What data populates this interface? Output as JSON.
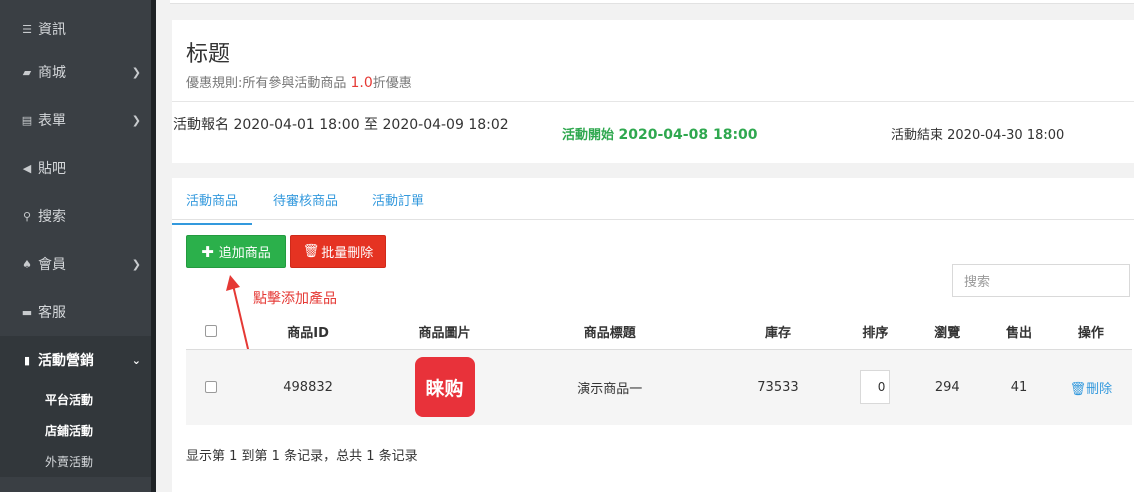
{
  "sidebar": {
    "items": [
      {
        "label": "資訊",
        "icon": "list-icon",
        "chevron": false
      },
      {
        "label": "商城",
        "icon": "cart-icon",
        "chevron": true
      },
      {
        "label": "表單",
        "icon": "form-icon",
        "chevron": true
      },
      {
        "label": "貼吧",
        "icon": "megaphone-icon",
        "chevron": false
      },
      {
        "label": "搜索",
        "icon": "search-icon",
        "chevron": false
      },
      {
        "label": "會員",
        "icon": "bell-icon",
        "chevron": true
      },
      {
        "label": "客服",
        "icon": "chat-icon",
        "chevron": false
      },
      {
        "label": "活動營銷",
        "icon": "bookmark-icon",
        "chevron": true
      }
    ],
    "sub_items": [
      "平台活動",
      "店鋪活動",
      "外賣活動"
    ]
  },
  "header": {
    "title": "标题",
    "rule_prefix": "優惠規則:所有參與活動商品 ",
    "rule_value": "1.0",
    "rule_suffix": "折優惠",
    "period": "活動報名 2020-04-01 18:00 至 2020-04-09 18:02",
    "start_label": "活動開始 ",
    "start_date": "2020-04-08 18:00",
    "end": "活動結束 2020-04-30 18:00"
  },
  "tabs": [
    "活動商品",
    "待審核商品",
    "活動訂單"
  ],
  "toolbar": {
    "add_label": "追加商品",
    "batch_delete_label": "批量刪除",
    "search_placeholder": "搜索"
  },
  "annotation": "點擊添加產品",
  "table": {
    "headers": [
      "商品ID",
      "商品圖片",
      "商品標題",
      "庫存",
      "排序",
      "瀏覽",
      "售出",
      "操作"
    ],
    "rows": [
      {
        "id": "498832",
        "image_text": "睐购",
        "title": "演示商品一",
        "stock": "73533",
        "sort": "0",
        "views": "294",
        "sold": "41",
        "action": "刪除"
      }
    ]
  },
  "footer": "显示第 1 到第 1 条记录，总共 1 条记录",
  "colors": {
    "sidebar_bg": "#3a3f44",
    "accent_blue": "#3399dd",
    "green": "#2bb04b",
    "red": "#e53322",
    "start_green": "#2fa84f"
  }
}
